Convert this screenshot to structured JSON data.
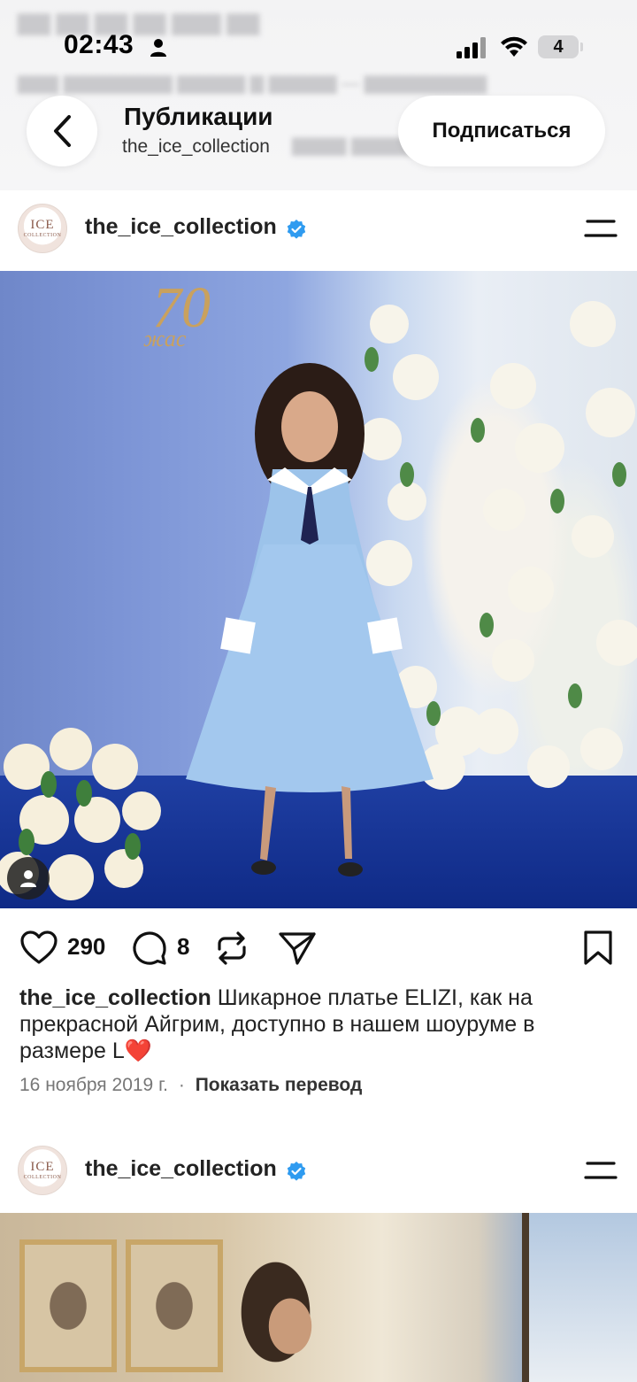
{
  "status_bar": {
    "time": "02:43",
    "battery": "4"
  },
  "header": {
    "title": "Публикации",
    "subtitle": "the_ice_collection",
    "follow_label": "Подписаться"
  },
  "posts": [
    {
      "username": "the_ice_collection",
      "avatar_text": "ICE",
      "avatar_subtext": "COLLECTION",
      "photo_text": "70",
      "photo_subtext": "жас",
      "likes": "290",
      "comments": "8",
      "caption_user": "the_ice_collection",
      "caption_text": "Шикарное платье ELIZI, как на прекрасной Айгрим, доступно в нашем шоуруме в размере L❤️",
      "date": "16 ноября 2019 г.",
      "separator": "·",
      "translate_label": "Показать перевод"
    },
    {
      "username": "the_ice_collection",
      "avatar_text": "ICE",
      "avatar_subtext": "COLLECTION"
    }
  ],
  "icons": {
    "back": "chevron-left-icon",
    "menu": "menu-icon",
    "like": "heart-icon",
    "comment": "comment-icon",
    "repost": "repost-icon",
    "share": "send-icon",
    "save": "bookmark-icon",
    "verified": "verified-badge-icon",
    "account": "person-icon"
  },
  "colors": {
    "verified": "#2f9bf0",
    "heart": "#e0202e"
  }
}
